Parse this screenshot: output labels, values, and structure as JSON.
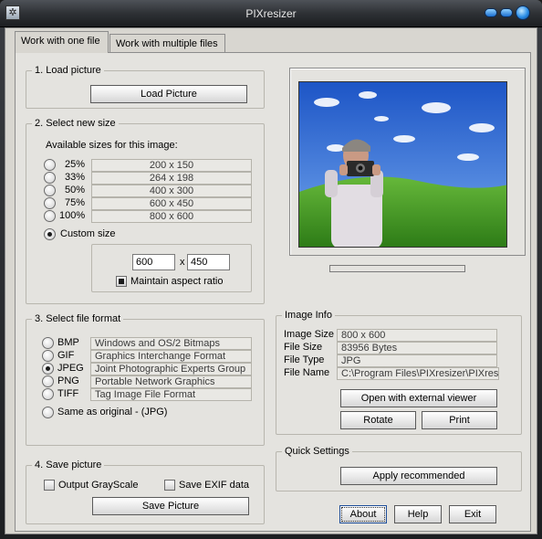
{
  "window": {
    "title": "PIXresizer"
  },
  "tabs": [
    "Work with one file",
    "Work with multiple files"
  ],
  "load": {
    "title": "1. Load picture",
    "button": "Load Picture"
  },
  "size": {
    "title": "2. Select new size",
    "available_label": "Available sizes for this image:",
    "options": [
      {
        "percent": "25%",
        "dims": "200  x  150"
      },
      {
        "percent": "33%",
        "dims": "264  x  198"
      },
      {
        "percent": "50%",
        "dims": "400  x  300"
      },
      {
        "percent": "75%",
        "dims": "600  x  450"
      },
      {
        "percent": "100%",
        "dims": "800  x  600"
      }
    ],
    "custom_label": "Custom size",
    "custom_width": "600",
    "times": "x",
    "custom_height": "450",
    "maintain_label": "Maintain aspect ratio"
  },
  "format": {
    "title": "3. Select file format",
    "options": [
      {
        "code": "BMP",
        "desc": "Windows and OS/2 Bitmaps"
      },
      {
        "code": "GIF",
        "desc": "Graphics Interchange Format"
      },
      {
        "code": "JPEG",
        "desc": "Joint Photographic Experts Group"
      },
      {
        "code": "PNG",
        "desc": "Portable Network Graphics"
      },
      {
        "code": "TIFF",
        "desc": "Tag Image File Format"
      }
    ],
    "same_label": "Same as original  - (JPG)"
  },
  "save": {
    "title": "4. Save picture",
    "grayscale_label": "Output GrayScale",
    "exif_label": "Save EXIF data",
    "button": "Save Picture"
  },
  "info": {
    "title": "Image Info",
    "rows": [
      {
        "label": "Image Size",
        "value": "800 x 600"
      },
      {
        "label": "File Size",
        "value": "83956 Bytes"
      },
      {
        "label": "File Type",
        "value": "JPG"
      },
      {
        "label": "File Name",
        "value": "C:\\Program Files\\PIXresizer\\PIXresiz"
      }
    ],
    "open_button": "Open with external viewer",
    "rotate_button": "Rotate",
    "print_button": "Print"
  },
  "quick": {
    "title": "Quick Settings",
    "button": "Apply recommended"
  },
  "footer": {
    "about": "About",
    "help": "Help",
    "exit": "Exit"
  },
  "colors": {
    "sky": "#2f6fd6",
    "grass": "#3f9a24",
    "title_bar": "#2e3135"
  }
}
